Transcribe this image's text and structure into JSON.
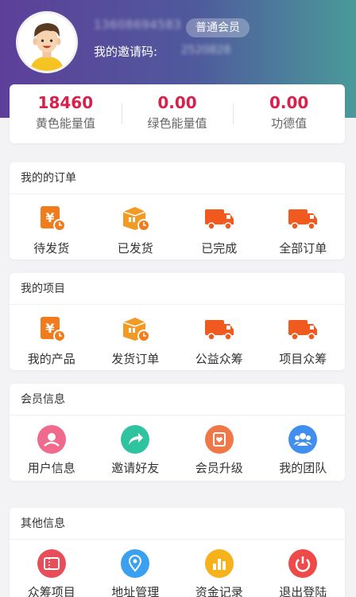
{
  "profile": {
    "phone": "13608694583",
    "member_level": "普通会员",
    "invite_label": "我的邀请码:",
    "invite_code": "2520828"
  },
  "stats": [
    {
      "value": "18460",
      "label": "黄色能量值"
    },
    {
      "value": "0.00",
      "label": "绿色能量值"
    },
    {
      "value": "0.00",
      "label": "功德值"
    }
  ],
  "orders": {
    "title": "我的的订单",
    "items": [
      {
        "label": "待发货",
        "icon": "yen-clock-icon"
      },
      {
        "label": "已发货",
        "icon": "box-clock-icon"
      },
      {
        "label": "已完成",
        "icon": "truck-icon"
      },
      {
        "label": "全部订单",
        "icon": "truck-icon"
      }
    ]
  },
  "projects": {
    "title": "我的项目",
    "items": [
      {
        "label": "我的产品",
        "icon": "yen-clock-icon"
      },
      {
        "label": "发货订单",
        "icon": "box-clock-icon"
      },
      {
        "label": "公益众筹",
        "icon": "truck-icon"
      },
      {
        "label": "项目众筹",
        "icon": "truck-icon"
      }
    ]
  },
  "member_info": {
    "title": "会员信息",
    "items": [
      {
        "label": "用户信息",
        "icon": "user-info-icon",
        "color": "#ef6a8c"
      },
      {
        "label": "邀请好友",
        "icon": "share-arrow-icon",
        "color": "#2fc3a0"
      },
      {
        "label": "会员升级",
        "icon": "upgrade-icon",
        "color": "#f07848"
      },
      {
        "label": "我的团队",
        "icon": "team-icon",
        "color": "#3f8ef0"
      }
    ]
  },
  "other_info": {
    "title": "其他信息",
    "items": [
      {
        "label": "众筹项目",
        "icon": "ticket-icon",
        "color": "#e84d5a"
      },
      {
        "label": "地址管理",
        "icon": "location-icon",
        "color": "#3aa0f0"
      },
      {
        "label": "资金记录",
        "icon": "bar-chart-icon",
        "color": "#f5b21a"
      },
      {
        "label": "退出登陆",
        "icon": "power-icon",
        "color": "#ef4a4a"
      }
    ]
  }
}
